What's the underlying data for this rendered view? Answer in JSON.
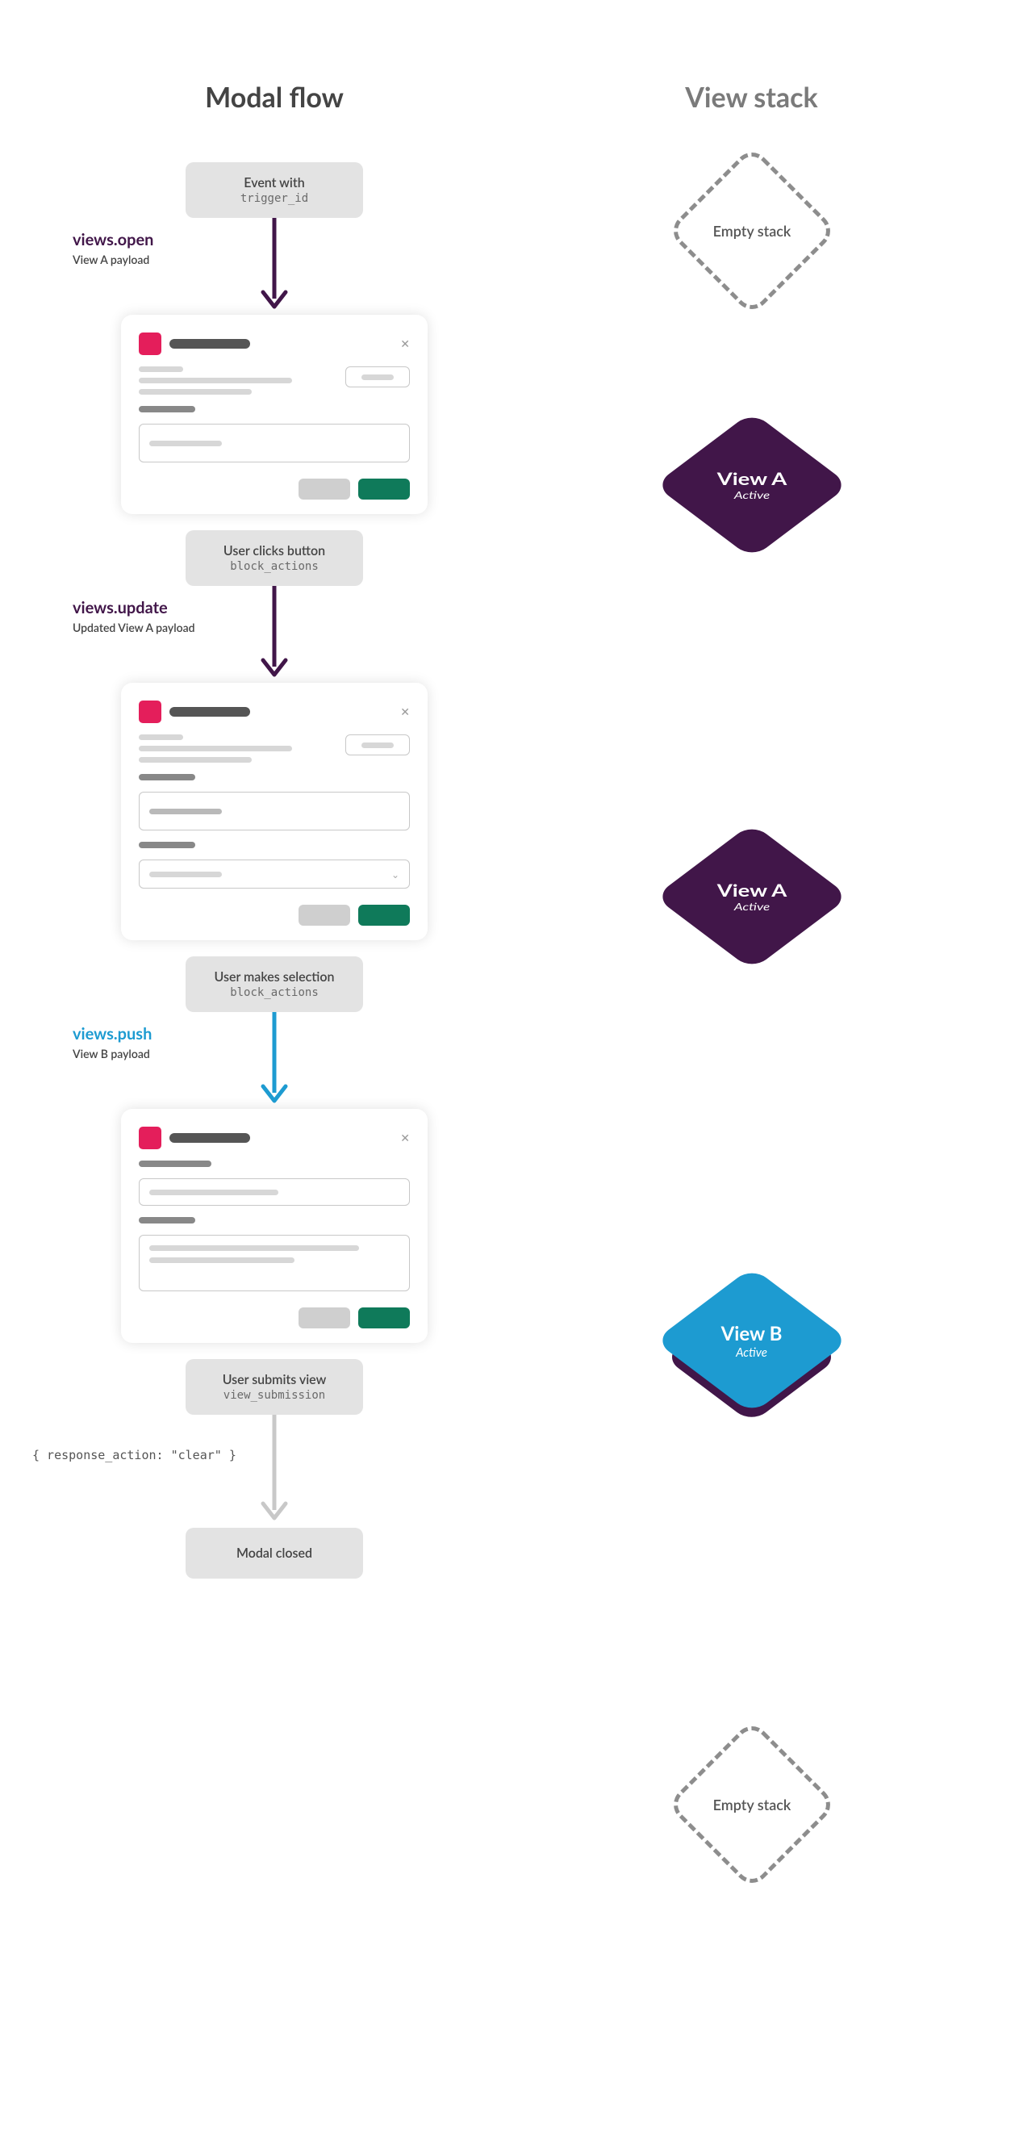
{
  "titles": {
    "left": "Modal flow",
    "right": "View stack"
  },
  "colors": {
    "purple": "#411649",
    "blue": "#1d9bd1",
    "gray_arrow": "#c3c3c3",
    "green_btn": "#0f7a5a",
    "pink_app": "#e41e5b"
  },
  "events": {
    "trigger": {
      "label": "Event with",
      "code": "trigger_id"
    },
    "click": {
      "label": "User clicks button",
      "code": "block_actions"
    },
    "select": {
      "label": "User makes selection",
      "code": "block_actions"
    },
    "submit": {
      "label": "User submits view",
      "code": "view_submission"
    },
    "closed": {
      "label": "Modal closed"
    },
    "response_clear": "{ response_action: \"clear\" }"
  },
  "calls": {
    "open": {
      "method": "views.open",
      "payload": "View A payload"
    },
    "update": {
      "method": "views.update",
      "payload": "Updated View A payload"
    },
    "push": {
      "method": "views.push",
      "payload": "View B payload"
    }
  },
  "stack": {
    "empty": "Empty stack",
    "viewA": {
      "title": "View A",
      "state": "Active"
    },
    "viewB": {
      "title": "View B",
      "state": "Active"
    }
  }
}
